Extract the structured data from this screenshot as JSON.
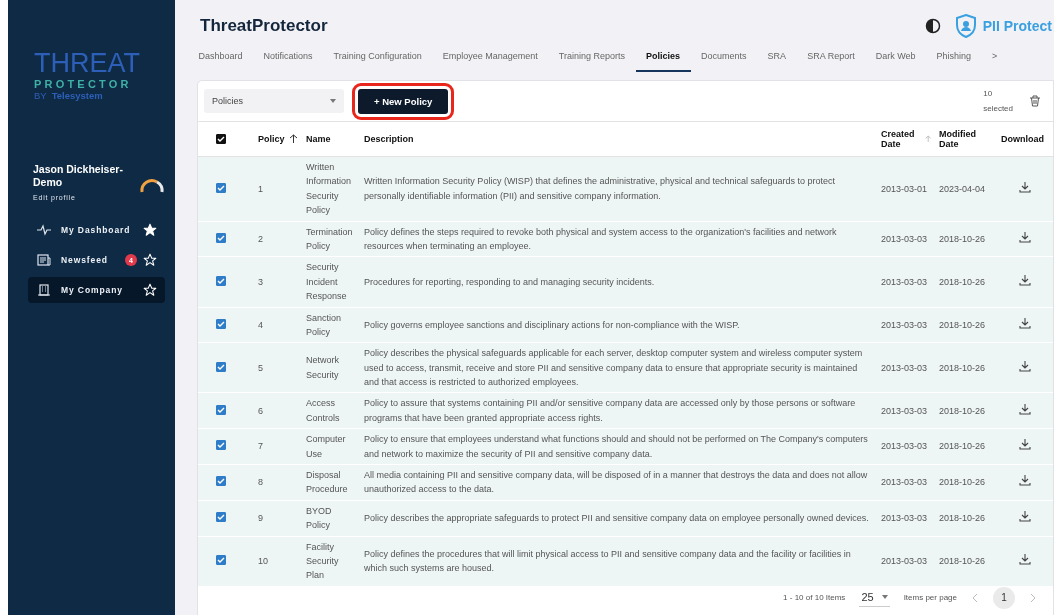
{
  "sidebar": {
    "logo": {
      "line_1": "THREAT",
      "line_2": "PROTECTOR",
      "by": "BY",
      "brand": "Telesystem"
    },
    "profile": {
      "name": "Jason Dickheiser-Demo",
      "edit_link": "Edit profile"
    },
    "items": [
      {
        "label": "My Dashboard",
        "kind": "pulse",
        "starred": true,
        "selected": false
      },
      {
        "label": "Newsfeed",
        "kind": "news",
        "badge": "4",
        "starred": false,
        "selected": false
      },
      {
        "label": "My Company",
        "kind": "building",
        "starred": false,
        "selected": true
      }
    ]
  },
  "header": {
    "title": "ThreatProtector",
    "brand": "PII Protect",
    "tabs": [
      {
        "label": "Dashboard",
        "selected": false
      },
      {
        "label": "Notifications",
        "selected": false
      },
      {
        "label": "Training Configuration",
        "selected": false
      },
      {
        "label": "Employee Management",
        "selected": false
      },
      {
        "label": "Training Reports",
        "selected": false
      },
      {
        "label": "Policies",
        "selected": true
      },
      {
        "label": "Documents",
        "selected": false
      },
      {
        "label": "SRA",
        "selected": false
      },
      {
        "label": "SRA Report",
        "selected": false
      },
      {
        "label": "Dark Web",
        "selected": false
      },
      {
        "label": "Phishing",
        "selected": false
      }
    ],
    "more": ">"
  },
  "toolbar": {
    "filter": "Policies",
    "new_button": "+ New Policy",
    "highlighted": true,
    "selected_count": "10",
    "selected_label": "selected"
  },
  "table": {
    "all_checked": true,
    "columns": [
      "Policy",
      "Name",
      "Description",
      "Created Date",
      "Modified Date",
      "Download"
    ],
    "rows": [
      {
        "checked": true,
        "policy": "1",
        "name": "Written Information Security Policy",
        "description": "Written Information Security Policy (WISP) that defines the administrative, physical and technical safeguards to protect personally identifiable information (PII) and sensitive company information.",
        "created": "2013-03-01",
        "modified": "2023-04-04"
      },
      {
        "checked": true,
        "policy": "2",
        "name": "Termination Policy",
        "description": "Policy defines the steps required to revoke both physical and system access to the organization's facilities and network resources when terminating an employee.",
        "created": "2013-03-03",
        "modified": "2018-10-26"
      },
      {
        "checked": true,
        "policy": "3",
        "name": "Security Incident Response",
        "description": "Procedures for reporting, responding to and managing security incidents.",
        "created": "2013-03-03",
        "modified": "2018-10-26"
      },
      {
        "checked": true,
        "policy": "4",
        "name": "Sanction Policy",
        "description": "Policy governs employee sanctions and disciplinary actions for non-compliance with the WISP.",
        "created": "2013-03-03",
        "modified": "2018-10-26"
      },
      {
        "checked": true,
        "policy": "5",
        "name": "Network Security",
        "description": "Policy describes the physical safeguards applicable for each server, desktop computer system and wireless computer system used to access, transmit, receive and store PII and sensitive company data to ensure that appropriate security is maintained and that access is restricted to authorized employees.",
        "created": "2013-03-03",
        "modified": "2018-10-26"
      },
      {
        "checked": true,
        "policy": "6",
        "name": "Access Controls",
        "description": "Policy to assure that systems containing PII and/or sensitive company data are accessed only by those persons or software programs that have been granted appropriate access rights.",
        "created": "2013-03-03",
        "modified": "2018-10-26"
      },
      {
        "checked": true,
        "policy": "7",
        "name": "Computer Use",
        "description": "Policy to ensure that employees understand what functions should and should not be performed on The Company's computers and network to maximize the security of PII and sensitive company data.",
        "created": "2013-03-03",
        "modified": "2018-10-26"
      },
      {
        "checked": true,
        "policy": "8",
        "name": "Disposal Procedure",
        "description": "All media containing PII and sensitive company data, will be disposed of in a manner that destroys the data and does not allow unauthorized access to the data.",
        "created": "2013-03-03",
        "modified": "2018-10-26"
      },
      {
        "checked": true,
        "policy": "9",
        "name": "BYOD Policy",
        "description": "Policy describes the appropriate safeguards to protect PII and sensitive company data on employee personally owned devices.",
        "created": "2013-03-03",
        "modified": "2018-10-26"
      },
      {
        "checked": true,
        "policy": "10",
        "name": "Facility Security Plan",
        "description": "Policy defines the procedures that will limit physical access to PII and sensitive company data and the facility or facilities in which such systems are housed.",
        "created": "2013-03-03",
        "modified": "2018-10-26"
      }
    ]
  },
  "pagination": {
    "range": "1 - 10 of 10 Items",
    "page_size": "25",
    "page_size_label": "Items per page",
    "pages": [
      {
        "label": "1",
        "selected": true
      }
    ]
  }
}
